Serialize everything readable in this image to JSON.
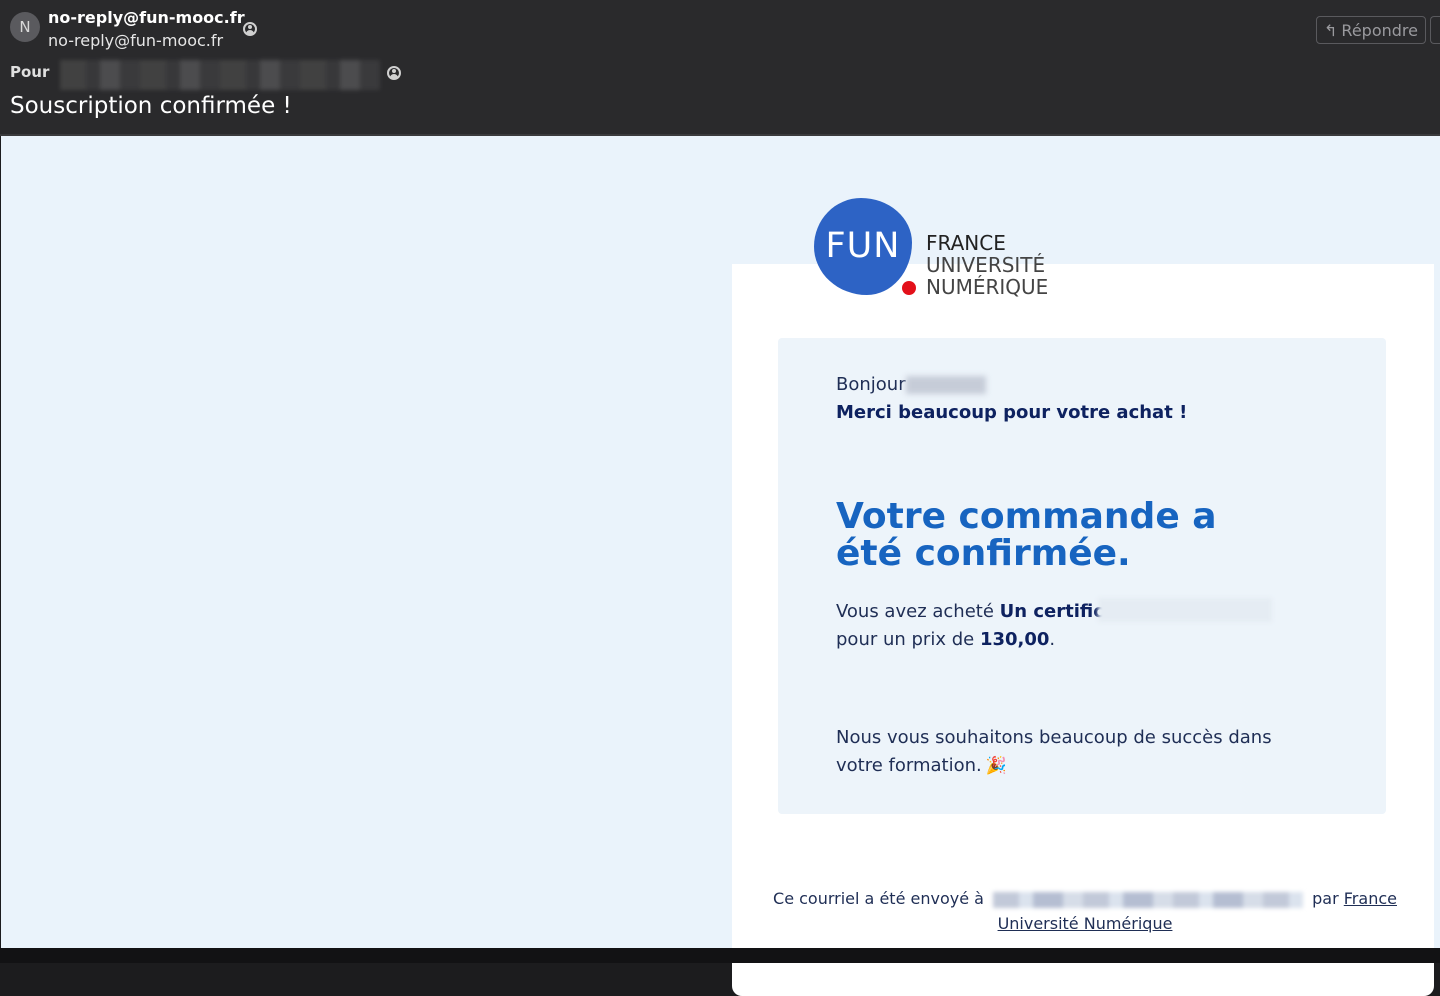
{
  "header": {
    "avatar_letter": "N",
    "sender_name": "no-reply@fun-mooc.fr",
    "sender_email": "no-reply@fun-mooc.fr",
    "to_label": "Pour",
    "subject": "Souscription confirmée !",
    "reply_label": "Répondre"
  },
  "email": {
    "logo": {
      "mark": "FUN",
      "line1": "FRANCE",
      "line2": "UNIVERSITÉ",
      "line3": "NUMÉRIQUE"
    },
    "greeting": "Bonjour",
    "thanks": "Merci beaucoup pour votre achat !",
    "headline": "Votre commande a été confirmée.",
    "purchase_prefix": "Vous avez acheté ",
    "purchase_item": "Un certificat",
    "price_prefix": "pour un prix de ",
    "price": "130,00",
    "price_suffix": ".",
    "wish": "Nous vous souhaitons beaucoup de succès dans votre formation.",
    "party_icon": "🎉",
    "footer_prefix": "Ce courriel a été envoyé à",
    "footer_par": "par",
    "footer_link": "France Université Numérique"
  }
}
